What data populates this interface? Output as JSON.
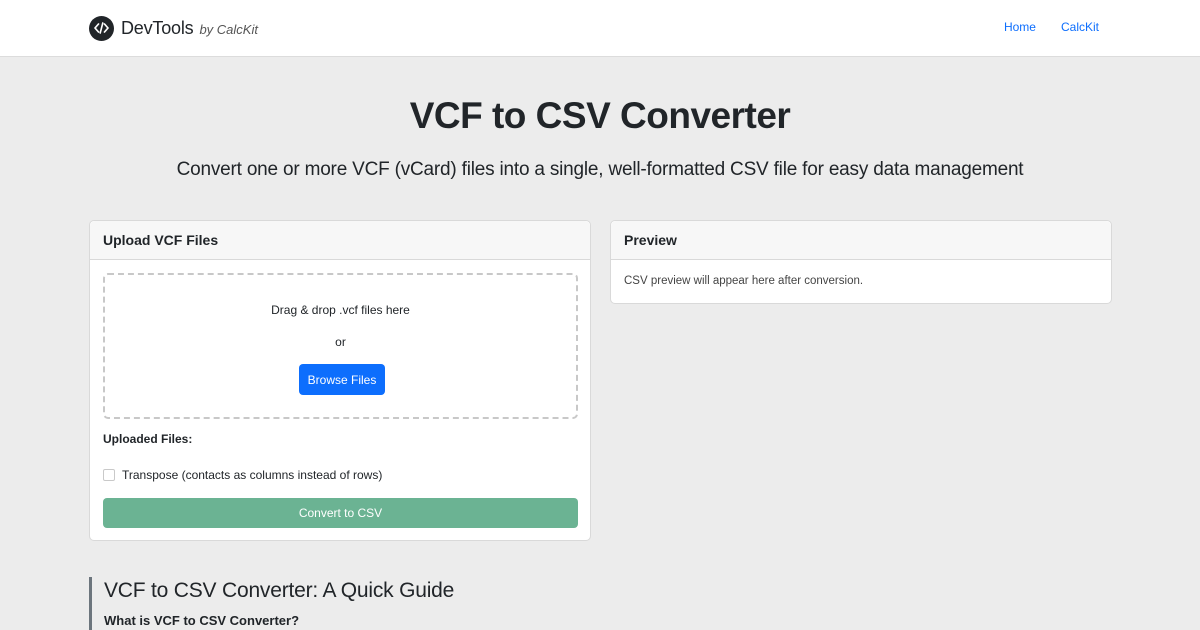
{
  "navbar": {
    "brand_name": "DevTools",
    "brand_by": "by CalcKit",
    "links": [
      {
        "label": "Home"
      },
      {
        "label": "CalcKit"
      }
    ]
  },
  "hero": {
    "title": "VCF to CSV Converter",
    "subtitle": "Convert one or more VCF (vCard) files into a single, well-formatted CSV file for easy data management"
  },
  "upload": {
    "header": "Upload VCF Files",
    "drop_text": "Drag & drop .vcf files here",
    "or_text": "or",
    "browse_label": "Browse Files",
    "uploaded_label": "Uploaded Files:",
    "transpose_label": "Transpose (contacts as columns instead of rows)",
    "transpose_checked": false,
    "convert_label": "Convert to CSV"
  },
  "preview": {
    "header": "Preview",
    "placeholder": "CSV preview will appear here after conversion."
  },
  "guide": {
    "title": "VCF to CSV Converter: A Quick Guide",
    "subtitle": "What is VCF to CSV Converter?"
  },
  "colors": {
    "primary": "#0d6efd",
    "convert_disabled": "#6bb393",
    "background": "#ececec"
  },
  "icons": {
    "brand_logo": "code-icon"
  }
}
